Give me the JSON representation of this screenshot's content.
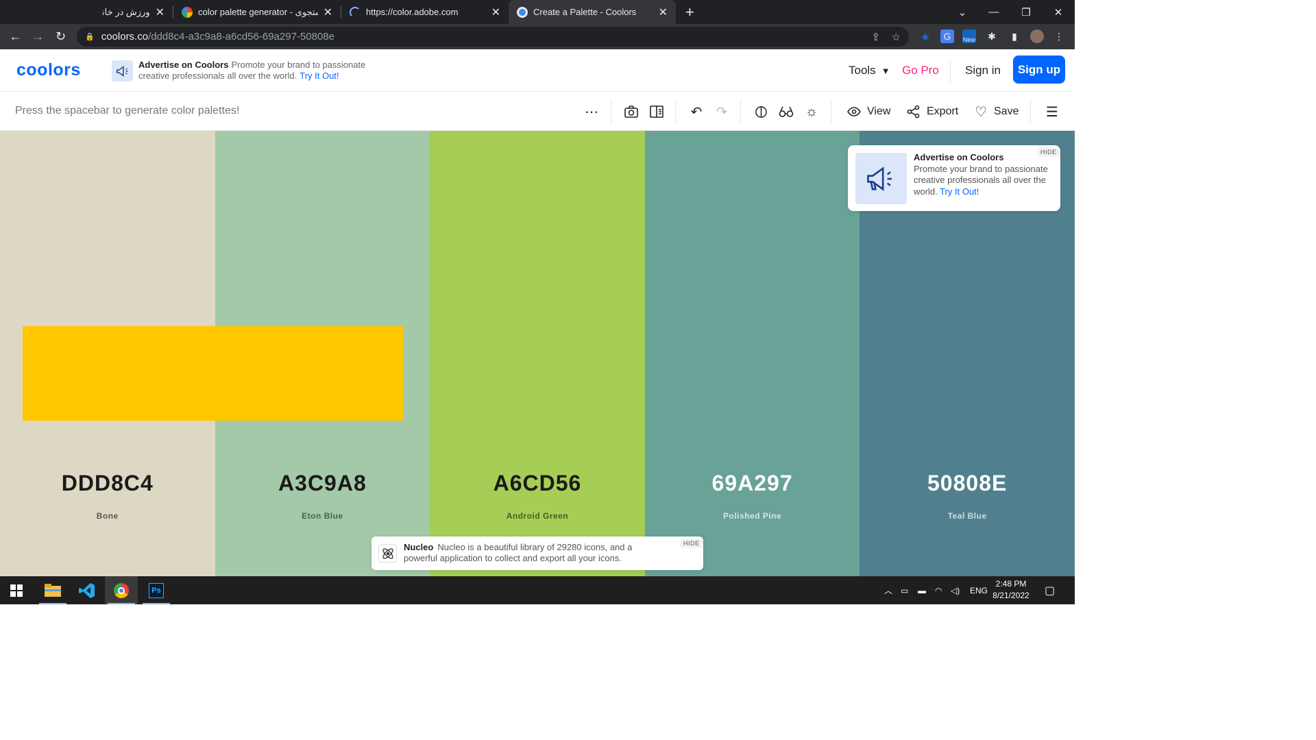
{
  "browser": {
    "tabs": [
      {
        "title": "ورزش در خانه",
        "active": false
      },
      {
        "title": "color palette generator - جستجوی",
        "active": false
      },
      {
        "title": "https://color.adobe.com",
        "active": false
      },
      {
        "title": "Create a Palette - Coolors",
        "active": true
      }
    ],
    "new_tab": "+",
    "url_host": "coolors.co",
    "url_path": "/ddd8c4-a3c9a8-a6cd56-69a297-50808e",
    "ext_badge": "New"
  },
  "header": {
    "logo": "coolors",
    "ad_title": "Advertise on Coolors",
    "ad_body": "Promote your brand to passionate creative professionals all over the world.",
    "ad_link": "Try It Out!",
    "tools": "Tools",
    "go_pro": "Go Pro",
    "sign_in": "Sign in",
    "sign_up": "Sign up"
  },
  "toolbar": {
    "hint": "Press the spacebar to generate color palettes!",
    "view": "View",
    "export": "Export",
    "save": "Save"
  },
  "palette": [
    {
      "hex": "DDD8C4",
      "name": "Bone",
      "color": "#ddd8c4",
      "text": "#1a1a1a",
      "sub": "#555555"
    },
    {
      "hex": "A3C9A8",
      "name": "Eton Blue",
      "color": "#a3c9a8",
      "text": "#1a1a1a",
      "sub": "#4b5e4e"
    },
    {
      "hex": "A6CD56",
      "name": "Android Green",
      "color": "#a6cd56",
      "text": "#1a1a1a",
      "sub": "#4a5c25"
    },
    {
      "hex": "69A297",
      "name": "Polished Pine",
      "color": "#69a297",
      "text": "#ffffff",
      "sub": "#d5e6e2"
    },
    {
      "hex": "50808E",
      "name": "Teal Blue",
      "color": "#50808e",
      "text": "#ffffff",
      "sub": "#d0dde1"
    }
  ],
  "overlay_color": "#ffc700",
  "ad_card": {
    "title": "Advertise on Coolors",
    "body": "Promote your brand to passionate creative professionals all over the world.",
    "link": "Try It Out!",
    "hide": "HIDE"
  },
  "nucleo": {
    "title": "Nucleo",
    "body": "Nucleo is a beautiful library of 29280 icons, and a powerful application to collect and export all your icons.",
    "hide": "HIDE"
  },
  "taskbar": {
    "lang": "ENG",
    "time": "2:48 PM",
    "date": "8/21/2022",
    "ps_label": "Ps"
  }
}
